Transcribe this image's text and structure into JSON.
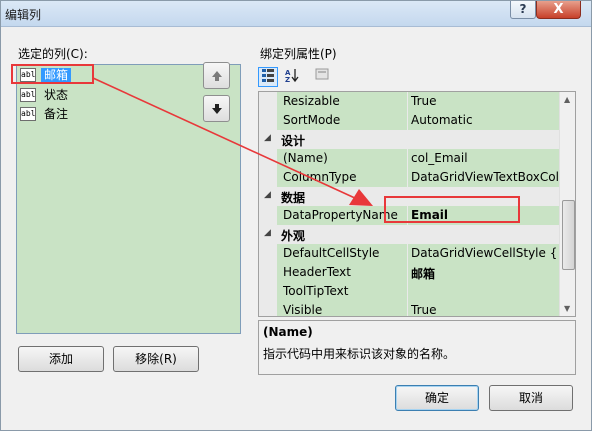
{
  "window": {
    "title": "编辑列",
    "help_label": "?",
    "close_label": "X"
  },
  "columns_panel": {
    "label": "选定的列(C):",
    "items": [
      {
        "icon": "abl",
        "label": "邮箱",
        "selected": true
      },
      {
        "icon": "abl",
        "label": "状态",
        "selected": false
      },
      {
        "icon": "abl",
        "label": "备注",
        "selected": false
      }
    ],
    "add_label": "添加",
    "remove_label": "移除(R)"
  },
  "properties_panel": {
    "label": "绑定列属性(P)",
    "rows": [
      {
        "type": "prop",
        "name": "Resizable",
        "value": "True"
      },
      {
        "type": "prop",
        "name": "SortMode",
        "value": "Automatic"
      },
      {
        "type": "cat",
        "name": "设计"
      },
      {
        "type": "prop",
        "name": "(Name)",
        "value": "col_Email"
      },
      {
        "type": "prop",
        "name": "ColumnType",
        "value": "DataGridViewTextBoxColu"
      },
      {
        "type": "cat",
        "name": "数据"
      },
      {
        "type": "prop",
        "name": "DataPropertyName",
        "value": "Email",
        "bold": true
      },
      {
        "type": "cat",
        "name": "外观"
      },
      {
        "type": "prop",
        "name": "DefaultCellStyle",
        "value": "DataGridViewCellStyle { }"
      },
      {
        "type": "prop",
        "name": "HeaderText",
        "value": "邮箱",
        "bold": true
      },
      {
        "type": "prop",
        "name": "ToolTipText",
        "value": ""
      },
      {
        "type": "prop",
        "name": "Visible",
        "value": "True"
      }
    ],
    "description": {
      "title": "(Name)",
      "text": "指示代码中用来标识该对象的名称。"
    }
  },
  "footer": {
    "ok_label": "确定",
    "cancel_label": "取消"
  },
  "colors": {
    "highlight": "#c9e3c5",
    "selection": "#3399ff",
    "annotation": "#e8383a"
  }
}
